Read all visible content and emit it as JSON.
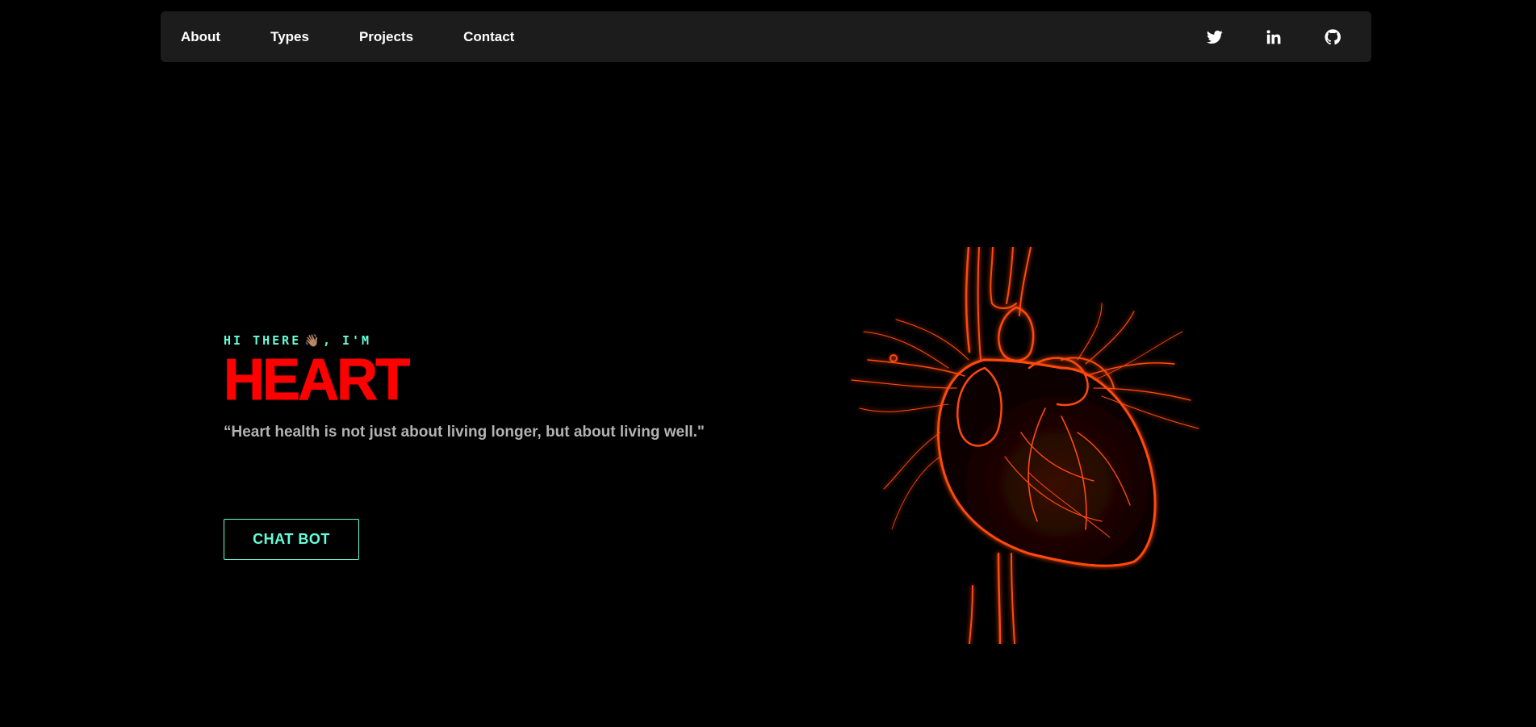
{
  "nav": {
    "links": [
      "About",
      "Types",
      "Projects",
      "Contact"
    ],
    "social": [
      {
        "name": "twitter-icon"
      },
      {
        "name": "linkedin-icon"
      },
      {
        "name": "github-icon"
      }
    ]
  },
  "hero": {
    "greeting_prefix": "HI THERE",
    "greeting_emoji": "👋🏽",
    "greeting_suffix": ", I'M",
    "title": "HEART",
    "quote": "“Heart health is not just about living longer, but about living well.\"",
    "button_label": "CHAT BOT"
  },
  "colors": {
    "background": "#000000",
    "navbar": "#1c1c1c",
    "accent": "#64ffda",
    "title": "#ff0000",
    "quote": "#b3b3b3",
    "heart_glow": "#ff4500"
  }
}
